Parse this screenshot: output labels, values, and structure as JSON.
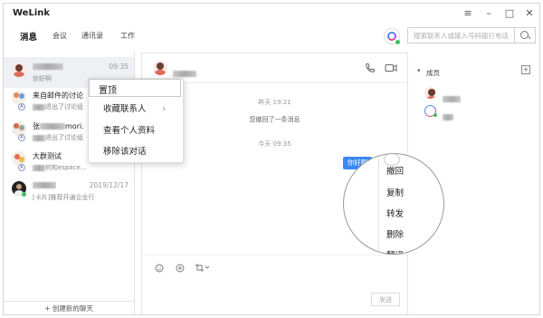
{
  "app": {
    "title": "WeLink"
  },
  "nav": {
    "tabs": [
      {
        "label": "消息",
        "active": true
      },
      {
        "label": "会议"
      },
      {
        "label": "通讯录"
      },
      {
        "label": "工作"
      }
    ]
  },
  "search": {
    "placeholder": "搜索联系人或输入号码拨打电话"
  },
  "conversations": [
    {
      "time": "09:35",
      "message": "你好啊"
    },
    {
      "name": "来自邮件的讨论",
      "message": "退出了讨论组"
    },
    {
      "name_suffix": "mori.",
      "message": "退出了讨论组"
    },
    {
      "name": "大群测试",
      "message": "何和espace..."
    },
    {
      "time": "2019/12/17",
      "message": "[卡片]推荐开通企业行"
    }
  ],
  "new_chat": {
    "label": "+ 创建新的聊天"
  },
  "chat": {
    "time_yesterday": "昨天 19:21",
    "system_recall": "您撤回了一条消息",
    "time_today": "今天 09:35",
    "bubble": "你好啊",
    "send_label": "发送"
  },
  "members": {
    "header": "成员"
  },
  "context_menu": {
    "items": [
      "置顶",
      "收藏联系人",
      "查看个人资料",
      "移除该对话"
    ]
  },
  "message_menu": {
    "items": [
      "撤回",
      "复制",
      "转发",
      "删除",
      "翻译"
    ]
  },
  "colors": {
    "accent": "#3a87f0",
    "online": "#3fbf5e"
  }
}
